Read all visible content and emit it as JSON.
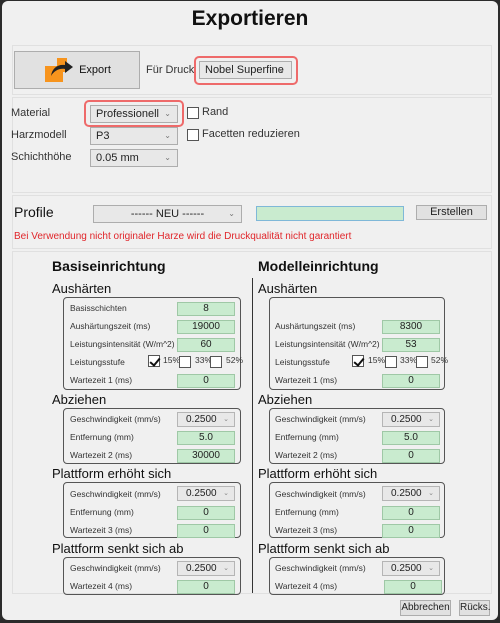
{
  "dialog": {
    "title": "Exportieren"
  },
  "top": {
    "export_label": "Export",
    "printer_label": "Für Druck",
    "printer_value": "Nobel Superfine"
  },
  "material": {
    "material_label": "Material",
    "material_value": "Professionell",
    "resin_label": "Harzmodell",
    "resin_value": "P3",
    "layer_label": "Schichthöhe",
    "layer_value": "0.05 mm",
    "rand_label": "Rand",
    "rand_checked": false,
    "facets_label": "Facetten reduzieren",
    "facets_checked": false
  },
  "profile": {
    "label": "Profile",
    "select_value": "------ NEU ------",
    "name_value": "",
    "create_label": "Erstellen",
    "warning": "Bei Verwendung nicht originaler Harze wird die Druckqualität nicht garantiert"
  },
  "base": {
    "title": "Basiseinrichtung",
    "curing": {
      "title": "Aushärten",
      "layers_label": "Basisschichten",
      "layers_value": "8",
      "time_label": "Aushärtungszeit (ms)",
      "time_value": "19000",
      "intensity_label": "Leistungsintensität (W/m^2)",
      "intensity_value": "60",
      "level_label": "Leistungsstufe",
      "levels": [
        {
          "label": "15%",
          "checked": true
        },
        {
          "label": "33%",
          "checked": false
        },
        {
          "label": "52%",
          "checked": false
        }
      ],
      "wait_label": "Wartezeit 1 (ms)",
      "wait_value": "0"
    },
    "peel": {
      "title": "Abziehen",
      "speed_label": "Geschwindigkeit (mm/s)",
      "speed_value": "0.2500",
      "distance_label": "Entfernung (mm)",
      "distance_value": "5.0",
      "wait_label": "Wartezeit 2 (ms)",
      "wait_value": "30000"
    },
    "rise": {
      "title": "Plattform erhöht sich",
      "speed_label": "Geschwindigkeit (mm/s)",
      "speed_value": "0.2500",
      "distance_label": "Entfernung (mm)",
      "distance_value": "0",
      "wait_label": "Wartezeit 3 (ms)",
      "wait_value": "0"
    },
    "lower": {
      "title": "Plattform senkt sich ab",
      "speed_label": "Geschwindigkeit (mm/s)",
      "speed_value": "0.2500",
      "wait_label": "Wartezeit 4 (ms)",
      "wait_value": "0"
    }
  },
  "model": {
    "title": "Modelleinrichtung",
    "curing": {
      "title": "Aushärten",
      "time_label": "Aushärtungszeit (ms)",
      "time_value": "8300",
      "intensity_label": "Leistungsintensität (W/m^2)",
      "intensity_value": "53",
      "level_label": "Leistungsstufe",
      "levels": [
        {
          "label": "15%",
          "checked": true
        },
        {
          "label": "33%",
          "checked": false
        },
        {
          "label": "52%",
          "checked": false
        }
      ],
      "wait_label": "Wartezeit 1 (ms)",
      "wait_value": "0"
    },
    "peel": {
      "title": "Abziehen",
      "speed_label": "Geschwindigkeit (mm/s)",
      "speed_value": "0.2500",
      "distance_label": "Entfernung (mm)",
      "distance_value": "5.0",
      "wait_label": "Wartezeit 2 (ms)",
      "wait_value": "0"
    },
    "rise": {
      "title": "Plattform erhöht sich",
      "speed_label": "Geschwindigkeit (mm/s)",
      "speed_value": "0.2500",
      "distance_label": "Entfernung (mm)",
      "distance_value": "0",
      "wait_label": "Wartezeit 3 (ms)",
      "wait_value": "0"
    },
    "lower": {
      "title": "Plattform senkt sich ab",
      "speed_label": "Geschwindigkeit (mm/s)",
      "speed_value": "0.2500",
      "wait_label": "Wartezeit 4 (ms)",
      "wait_value": "0"
    }
  },
  "footer": {
    "cancel_label": "Abbrechen",
    "reset_label": "Rücks."
  },
  "colors": {
    "highlight": "#ee6a6a",
    "warning": "#e0262b",
    "field_green": "#c9ebcf",
    "export_orange": "#f7941d"
  }
}
